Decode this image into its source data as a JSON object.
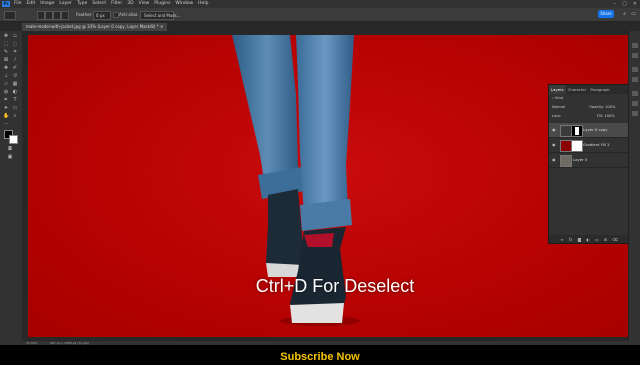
{
  "app": {
    "logo": "Ps",
    "menu": [
      "File",
      "Edit",
      "Image",
      "Layer",
      "Type",
      "Select",
      "Filter",
      "3D",
      "View",
      "Plugins",
      "Window",
      "Help"
    ],
    "window_buttons": [
      "–",
      "▢",
      "✕"
    ]
  },
  "options": {
    "feather_label": "Feather:",
    "feather_value": "0 px",
    "antialias_label": "Anti-alias",
    "select_mask_label": "Select and Mask...",
    "share_label": "Share"
  },
  "document": {
    "tab_title": "male-model-with-jacket.jpg @ 33% (Layer 0 copy, Layer Mask/8) * ✕"
  },
  "canvas": {
    "caption": "Ctrl+D For Deselect",
    "background_color": "#b70202"
  },
  "layers_panel": {
    "tabs": [
      "Layers",
      "Character",
      "Paragraph"
    ],
    "kind_label": "Kind",
    "blend_mode": "Normal",
    "opacity_label": "Opacity:",
    "opacity_value": "100%",
    "lock_label": "Lock:",
    "fill_label": "Fill:",
    "fill_value": "100%",
    "layers": [
      {
        "name": "Layer 0 copy",
        "selected": true
      },
      {
        "name": "Gradient Fill 1",
        "selected": false
      },
      {
        "name": "Layer 0",
        "selected": false
      }
    ],
    "bottom_icons": [
      "link-icon",
      "fx-icon",
      "mask-icon",
      "adjustment-icon",
      "folder-icon",
      "new-layer-icon",
      "trash-icon"
    ]
  },
  "status": {
    "zoom": "33.33%",
    "dimensions": "967 px x 1858 px (72 ppi)"
  },
  "banner": {
    "text": "Subscribe Now",
    "color": "#f5c400"
  }
}
